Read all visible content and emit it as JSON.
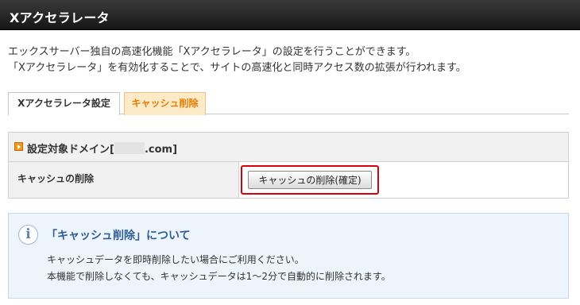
{
  "header": {
    "title": "Xアクセラレータ"
  },
  "description": {
    "line1": "エックスサーバー独自の高速化機能「Xアクセラレータ」の設定を行うことができます。",
    "line2": "「Xアクセラレータ」を有効化することで、サイトの高速化と同時アクセス数の拡張が行われます。"
  },
  "tabs": [
    {
      "label": "Xアクセラレータ設定",
      "active": false
    },
    {
      "label": "キャッシュ削除",
      "active": true
    }
  ],
  "domain": {
    "prefix": "設定対象ドメイン[",
    "suffix": ".com]"
  },
  "cache": {
    "label": "キャッシュの削除",
    "button_label": "キャッシュの削除(確定)"
  },
  "info": {
    "icon": "info-icon",
    "title": "「キャッシュ削除」について",
    "line1": "キャッシュデータを即時削除したい場合にご利用ください。",
    "line2": "本機能で削除しなくても、キャッシュデータは1～2分で自動的に削除されます。"
  },
  "colors": {
    "header_bg": "#1e1e1e",
    "active_tab_text": "#e57b05",
    "active_tab_bg": "#fdebc8",
    "highlight_border": "#d9000d",
    "info_title": "#2f5e96",
    "info_bg": "#eef4fb"
  }
}
